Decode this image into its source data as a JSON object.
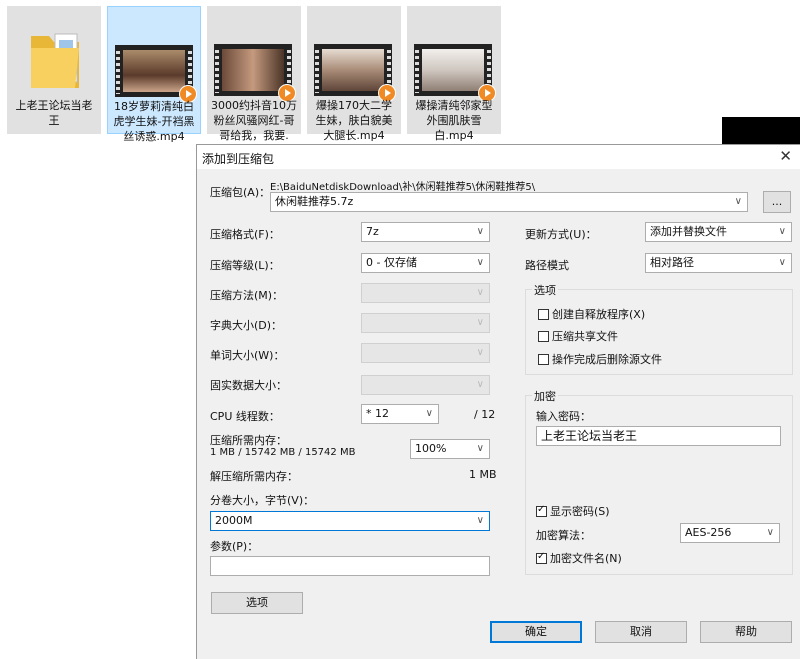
{
  "desktop": {
    "files": [
      {
        "name": "上老王论坛当老王",
        "type": "folder",
        "selected": false
      },
      {
        "name": "18岁萝莉清纯白虎学生妹-开裆黑丝诱惑.mp4",
        "type": "video",
        "selected": true
      },
      {
        "name": "3000约抖音10万粉丝风骚网红-哥哥给我，我要.",
        "type": "video",
        "selected": false
      },
      {
        "name": "爆操170大二学生妹，肤白貌美大腿长.mp4",
        "type": "video",
        "selected": false
      },
      {
        "name": "爆操清纯邻家型外围肌肤雪白.mp4",
        "type": "video",
        "selected": false
      }
    ]
  },
  "dialog": {
    "title": "添加到压缩包",
    "archive_label": "压缩包(A)：",
    "archive_path": "E:\\BaiduNetdiskDownload\\补\\休闲鞋推荐5\\休闲鞋推荐5\\",
    "archive_name": "休闲鞋推荐5.7z",
    "browse_label": "...",
    "format_label": "压缩格式(F)：",
    "format_value": "7z",
    "level_label": "压缩等级(L)：",
    "level_value": "0 - 仅存储",
    "method_label": "压缩方法(M)：",
    "dict_label": "字典大小(D)：",
    "word_label": "单词大小(W)：",
    "solid_label": "固实数据大小：",
    "cpu_label": "CPU 线程数：",
    "cpu_value": "* 12",
    "cpu_max": "/ 12",
    "mem_label": "压缩所需内存：",
    "mem_info": "1 MB / 15742 MB / 15742 MB",
    "mem_percent": "100%",
    "decomp_label": "解压缩所需内存：",
    "decomp_value": "1 MB",
    "volume_label": "分卷大小，字节(V)：",
    "volume_value": "2000M",
    "params_label": "参数(P)：",
    "params_value": "",
    "options_button": "选项",
    "update_label": "更新方式(U)：",
    "update_value": "添加并替换文件",
    "path_label": "路径模式",
    "path_value": "相对路径",
    "options_group": "选项",
    "opt_sfx": "创建自释放程序(X)",
    "opt_shared": "压缩共享文件",
    "opt_delete": "操作完成后删除源文件",
    "encrypt_group": "加密",
    "password_label": "输入密码：",
    "password_value": "上老王论坛当老王",
    "show_password": "显示密码(S)",
    "enc_method_label": "加密算法：",
    "enc_method_value": "AES-256",
    "encrypt_names": "加密文件名(N)",
    "ok": "确定",
    "cancel": "取消",
    "help": "帮助"
  },
  "colors": {
    "selected_tile": "#cce8ff",
    "accent": "#0078d7",
    "dialog_bg": "#f0f0f0"
  }
}
